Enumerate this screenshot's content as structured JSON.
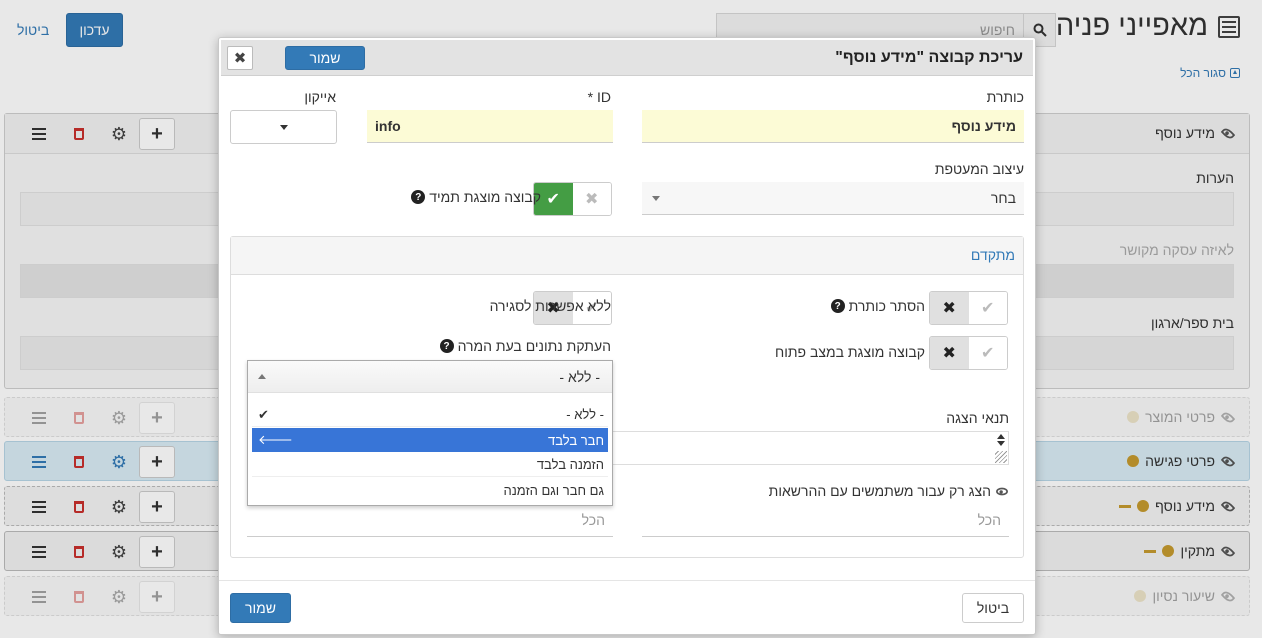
{
  "page": {
    "title": "מאפייני פניה",
    "search_placeholder": "חיפוש",
    "update_label": "עדכון",
    "cancel_label": "ביטול",
    "collapse_all": "סגור הכל"
  },
  "background_groups": {
    "open_group": {
      "name": "מידע נוסף",
      "fields": [
        "הערות",
        "לאיזה עסקה מקושר",
        "בית ספר/ארגון"
      ]
    },
    "rows": [
      {
        "name": "פרטי המוצר",
        "state": "faded"
      },
      {
        "name": "פרטי פגישה",
        "state": "active"
      },
      {
        "name": "מידע נוסף",
        "state": "normal"
      },
      {
        "name": "מתקין",
        "state": "normal"
      },
      {
        "name": "שיעור נסיון",
        "state": "faded"
      }
    ]
  },
  "modal": {
    "title": "עריכת קבוצה \"מידע נוסף\"",
    "save_label": "שמור",
    "close_glyph": "✖",
    "title_label": "כותרת",
    "title_value": "מידע נוסף",
    "id_label": "ID *",
    "id_value": "info",
    "icon_label": "אייקון",
    "wrapper_label": "עיצוב המעטפת",
    "wrapper_value": "בחר",
    "always_shown_label": "קבוצה מוצגת תמיד",
    "advanced": {
      "title": "מתקדם",
      "hide_title_label": "הסתר כותרת",
      "no_close_label": "ללא אפשרות לסגירה",
      "open_state_label": "קבוצה מוצגת במצב פתוח",
      "copy_data_label": "העתקת נתונים בעת המרה",
      "copy_data_value": "- ללא -",
      "display_condition_label": "תנאי הצגה",
      "registered_only_label": "הצג רק עבור משתמשים עם ההרשאות",
      "all_placeholder_left": "הכל",
      "all_placeholder_right": "הכל"
    },
    "dropdown_options": [
      {
        "label": "- ללא -",
        "selected": true
      },
      {
        "label": "חבר בלבד",
        "highlighted": true
      },
      {
        "label": "הזמנה בלבד"
      },
      {
        "label": "גם חבר וגם הזמנה"
      }
    ],
    "footer": {
      "save_label": "שמור",
      "cancel_label": "ביטול"
    }
  },
  "colors": {
    "primary": "#337ab7",
    "success": "#449d44",
    "danger": "#c9302c",
    "highlight": "#3875d7",
    "yellow_field": "#fcfbd6",
    "status_dot": "#c59a2f"
  }
}
